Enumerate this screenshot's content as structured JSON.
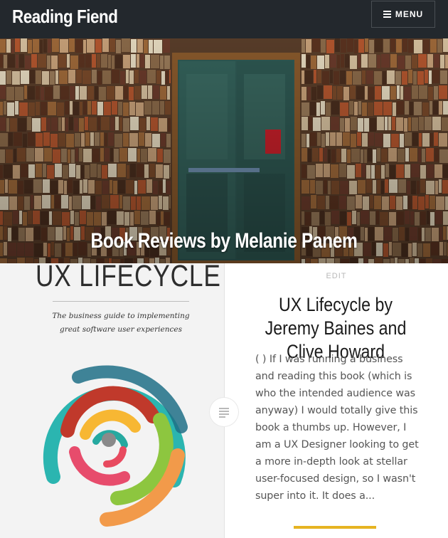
{
  "header": {
    "site_title": "Reading Fiend",
    "menu_label": "MENU"
  },
  "hero": {
    "title": "Book Reviews by Melanie Panem"
  },
  "post": {
    "edit_label": "EDIT",
    "title": "UX Lifecycle by Jeremy Baines and Clive Howard",
    "excerpt_lines": [
      "( ) If I was running a business",
      "and reading this book (which is",
      "who the intended audience was",
      "anyway) I would totally give this",
      "book a thumbs up. However, I",
      "am a UX Designer looking to get",
      "a more in-depth look at stellar",
      "user-focused design, so I wasn't",
      "super into it. It does a..."
    ],
    "cover": {
      "title": "UX LIFECYCLE",
      "subtitle": "The business guide to implementing great software user experiences"
    }
  },
  "icons": {
    "menu": "hamburger-icon",
    "post_format": "standard-post-icon"
  },
  "colors": {
    "header_bg": "#23282d",
    "accent": "#e6b422"
  }
}
